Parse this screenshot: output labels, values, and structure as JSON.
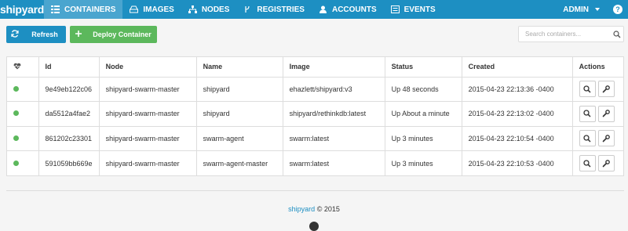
{
  "app": {
    "logo": "shipyard"
  },
  "nav": [
    {
      "label": "CONTAINERS",
      "icon": "grid-icon",
      "active": true
    },
    {
      "label": "IMAGES",
      "icon": "hdd-icon"
    },
    {
      "label": "NODES",
      "icon": "sitemap-icon"
    },
    {
      "label": "REGISTRIES",
      "icon": "fork-icon"
    },
    {
      "label": "ACCOUNTS",
      "icon": "user-icon"
    },
    {
      "label": "EVENTS",
      "icon": "list-icon"
    }
  ],
  "user": {
    "name": "ADMIN",
    "help": "?"
  },
  "toolbar": {
    "refresh_label": "Refresh",
    "deploy_label": "Deploy Container"
  },
  "search": {
    "placeholder": "Search containers..."
  },
  "table": {
    "columns": [
      "",
      "Id",
      "Node",
      "Name",
      "Image",
      "Status",
      "Created",
      "Actions"
    ],
    "rows": [
      {
        "id": "9e49eb122c06",
        "node": "shipyard-swarm-master",
        "name": "shipyard",
        "image": "ehazlett/shipyard:v3",
        "status": "Up 48 seconds",
        "created": "2015-04-23 22:13:36 -0400"
      },
      {
        "id": "da5512a4fae2",
        "node": "shipyard-swarm-master",
        "name": "shipyard",
        "image": "shipyard/rethinkdb:latest",
        "status": "Up About a minute",
        "created": "2015-04-23 22:13:02 -0400"
      },
      {
        "id": "861202c23301",
        "node": "shipyard-swarm-master",
        "name": "swarm-agent",
        "image": "swarm:latest",
        "status": "Up 3 minutes",
        "created": "2015-04-23 22:10:54 -0400"
      },
      {
        "id": "591059bb669e",
        "node": "shipyard-swarm-master",
        "name": "swarm-agent-master",
        "image": "swarm:latest",
        "status": "Up 3 minutes",
        "created": "2015-04-23 22:10:53 -0400"
      }
    ]
  },
  "footer": {
    "brand": "shipyard",
    "copyright": "© 2015"
  },
  "colors": {
    "primary": "#1d8fc2",
    "success": "#5cb85c",
    "active_tab": "#4aa5cf"
  }
}
